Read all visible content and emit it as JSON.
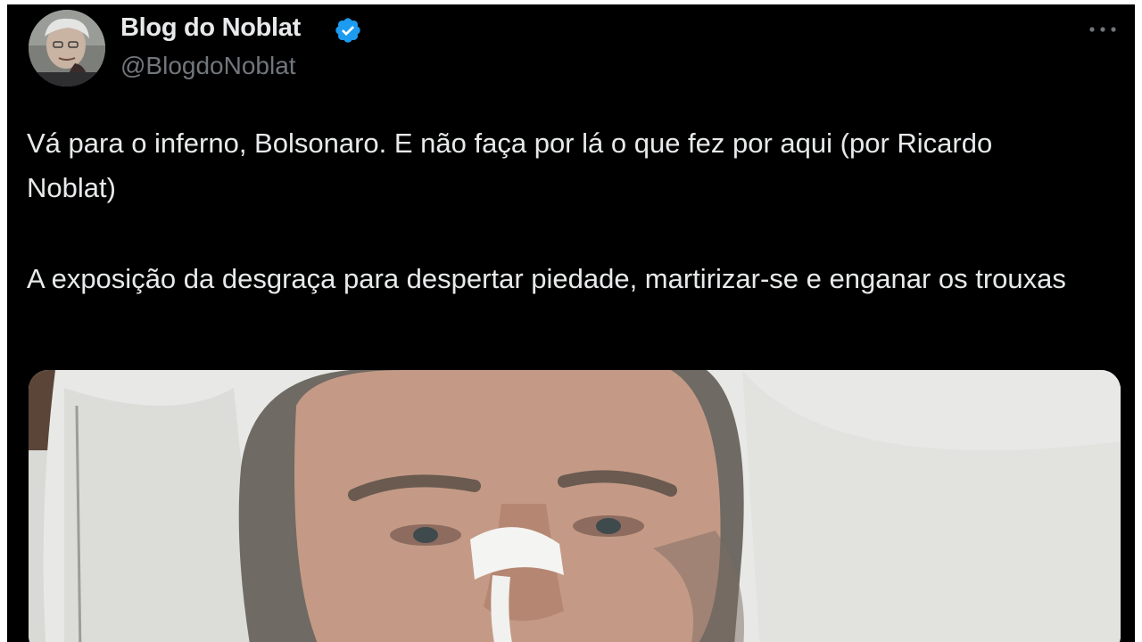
{
  "tweet": {
    "author": {
      "display_name": "Blog do Noblat",
      "handle": "@BlogdoNoblat",
      "verified": true,
      "avatar_icon": "profile-photo"
    },
    "paragraphs": [
      "Vá para o inferno, Bolsonaro. E não faça por lá o que fez por aqui (por Ricardo Noblat)",
      "A exposição da desgraça para despertar piedade, martirizar-se e enganar os trouxas"
    ],
    "media": {
      "kind": "photo",
      "alt": "man-in-hospital-bed-with-nasal-tube"
    },
    "more_icon": "ellipsis-icon"
  },
  "colors": {
    "background": "#000000",
    "text_primary": "#e7e9ea",
    "text_secondary": "#71767b",
    "verified_blue": "#1d9bf0"
  }
}
